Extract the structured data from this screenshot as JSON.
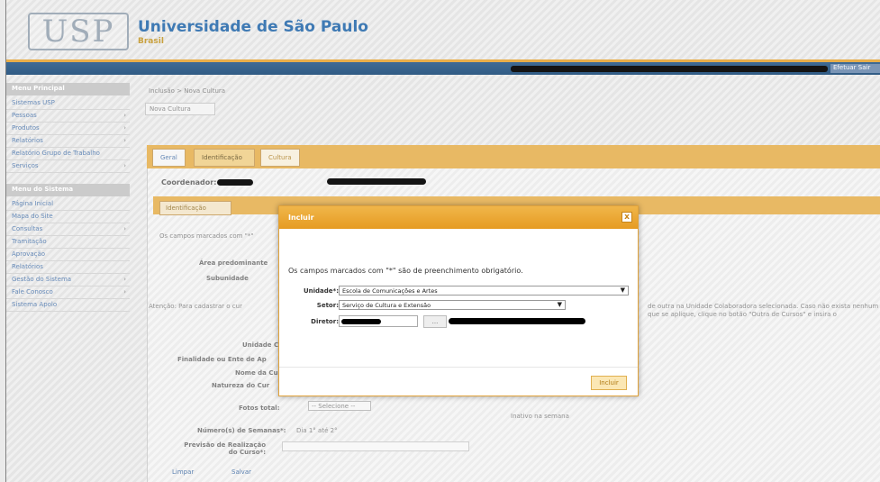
{
  "header": {
    "logo_text": "USP",
    "title": "Universidade de São Paulo",
    "subtitle": "Brasil",
    "logout_label": "Efetuar Sair"
  },
  "sidebar": {
    "section1_label": "Menu Principal",
    "section1_items": [
      {
        "label": "Sistemas USP",
        "arrow": ""
      },
      {
        "label": "Pessoas",
        "arrow": "›"
      },
      {
        "label": "Produtos",
        "arrow": "›"
      },
      {
        "label": "Relatórios",
        "arrow": "›"
      },
      {
        "label": "Relatório Grupo de Trabalho",
        "arrow": ""
      },
      {
        "label": "Serviços",
        "arrow": "›"
      }
    ],
    "section2_label": "Menu do Sistema",
    "section2_items": [
      {
        "label": "Página Inicial",
        "arrow": ""
      },
      {
        "label": "Mapa do Site",
        "arrow": ""
      },
      {
        "label": "Consultas",
        "arrow": "›"
      },
      {
        "label": "Tramitação",
        "arrow": ""
      },
      {
        "label": "Aprovação",
        "arrow": ""
      },
      {
        "label": "Relatórios",
        "arrow": ""
      },
      {
        "label": "Gestão do Sistema",
        "arrow": "›"
      },
      {
        "label": "Fale Conosco",
        "arrow": "›"
      },
      {
        "label": "Sistema Apolo",
        "arrow": ""
      }
    ]
  },
  "main": {
    "breadcrumb": "Inclusão > Nova Cultura",
    "subtitle_box": "Nova Cultura",
    "tabs": [
      {
        "label": "Geral"
      },
      {
        "label": "Identificação"
      },
      {
        "label": "Cultura"
      }
    ],
    "coordinator_label": "Coordenador:",
    "inner_tab": "Identificação",
    "required_note": "Os campos marcados com \"*\"",
    "form_labels": [
      "Área predominante",
      "Subunidade",
      "Unidade C",
      "Finalidade ou Ente de Ap",
      "Nome da Cu",
      "Natureza do Cur"
    ],
    "attention_text": "Atenção: Para cadastrar o cur",
    "attention_right": "de outra na Unidade Colaboradora selecionada. Caso não exista nenhum que se aplique, clique no botão \"Outra de Cursos\" e insira o",
    "field_labels": {
      "fotal": "Fotos total:",
      "semana": "Número(s) de Semanas*:",
      "previsao": "Previsão de Realização do Curso*:"
    },
    "select_default": "-- Selecione --",
    "semana_values": "Dia 1° até 2°",
    "bottom_link1": "Limpar",
    "bottom_link2": "Salvar",
    "aux_text": "Inativo na semana"
  },
  "modal": {
    "title": "Incluir",
    "close_label": "x",
    "message": "Os campos marcados com \"*\" são de preenchimento obrigatório.",
    "unidade_label": "Unidade*:",
    "unidade_value": "Escola de Comunicações e Artes",
    "setor_label": "Setor:",
    "setor_value": "Serviço de Cultura e Extensão",
    "diretor_label": "Diretor:",
    "lookup_label": "...",
    "submit_label": "Incluir"
  },
  "colors": {
    "accent_orange": "#e6a83b",
    "header_blue": "#2f6fae",
    "topbar_blue": "#1f4e7a"
  }
}
